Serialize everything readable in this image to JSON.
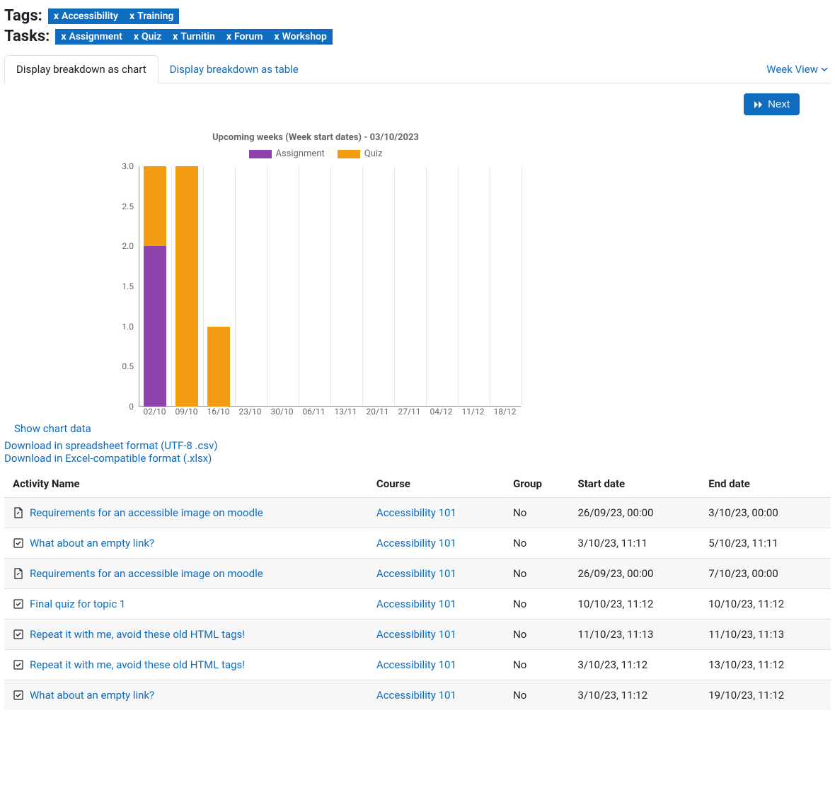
{
  "filters": {
    "tags_label": "Tags:",
    "tasks_label": "Tasks:",
    "tags": [
      "Accessibility",
      "Training"
    ],
    "tasks": [
      "Assignment",
      "Quiz",
      "Turnitin",
      "Forum",
      "Workshop"
    ]
  },
  "tabs": {
    "chart": "Display breakdown as chart",
    "table": "Display breakdown as table",
    "view": "Week View"
  },
  "toolbar": {
    "next": "Next"
  },
  "chart_data": {
    "type": "bar",
    "stacked": true,
    "title": "Upcoming weeks (Week start dates) - 03/10/2023",
    "categories": [
      "02/10",
      "09/10",
      "16/10",
      "23/10",
      "30/10",
      "06/11",
      "13/11",
      "20/11",
      "27/11",
      "04/12",
      "11/12",
      "18/12"
    ],
    "series": [
      {
        "name": "Assignment",
        "color": "#8e44ad",
        "values": [
          2,
          0,
          0,
          0,
          0,
          0,
          0,
          0,
          0,
          0,
          0,
          0
        ]
      },
      {
        "name": "Quiz",
        "color": "#f39c12",
        "values": [
          1,
          3,
          1,
          0,
          0,
          0,
          0,
          0,
          0,
          0,
          0,
          0
        ]
      }
    ],
    "ylim": [
      0,
      3
    ],
    "ystep": 0.5,
    "yticks": [
      "0",
      "0.5",
      "1.0",
      "1.5",
      "2.0",
      "2.5",
      "3.0"
    ],
    "xlabel": "",
    "ylabel": ""
  },
  "links": {
    "show_data": "Show chart data",
    "download_csv": "Download in spreadsheet format (UTF-8 .csv)",
    "download_xlsx": "Download in Excel-compatible format (.xlsx)"
  },
  "table": {
    "headers": [
      "Activity Name",
      "Course",
      "Group",
      "Start date",
      "End date"
    ],
    "rows": [
      {
        "icon": "file",
        "name": "Requirements for an accessible image on moodle",
        "course": "Accessibility 101",
        "group": "No",
        "start": "26/09/23, 00:00",
        "end": "3/10/23, 00:00"
      },
      {
        "icon": "check",
        "name": "What about an empty link?",
        "course": "Accessibility 101",
        "group": "No",
        "start": "3/10/23, 11:11",
        "end": "5/10/23, 11:11"
      },
      {
        "icon": "file",
        "name": "Requirements for an accessible image on moodle",
        "course": "Accessibility 101",
        "group": "No",
        "start": "26/09/23, 00:00",
        "end": "7/10/23, 00:00"
      },
      {
        "icon": "check",
        "name": "Final quiz for topic 1",
        "course": "Accessibility 101",
        "group": "No",
        "start": "10/10/23, 11:12",
        "end": "10/10/23, 11:12"
      },
      {
        "icon": "check",
        "name": "Repeat it with me, avoid these old HTML tags!",
        "course": "Accessibility 101",
        "group": "No",
        "start": "11/10/23, 11:13",
        "end": "11/10/23, 11:13"
      },
      {
        "icon": "check",
        "name": "Repeat it with me, avoid these old HTML tags!",
        "course": "Accessibility 101",
        "group": "No",
        "start": "3/10/23, 11:12",
        "end": "13/10/23, 11:12"
      },
      {
        "icon": "check",
        "name": "What about an empty link?",
        "course": "Accessibility 101",
        "group": "No",
        "start": "3/10/23, 11:12",
        "end": "19/10/23, 11:12"
      }
    ]
  }
}
